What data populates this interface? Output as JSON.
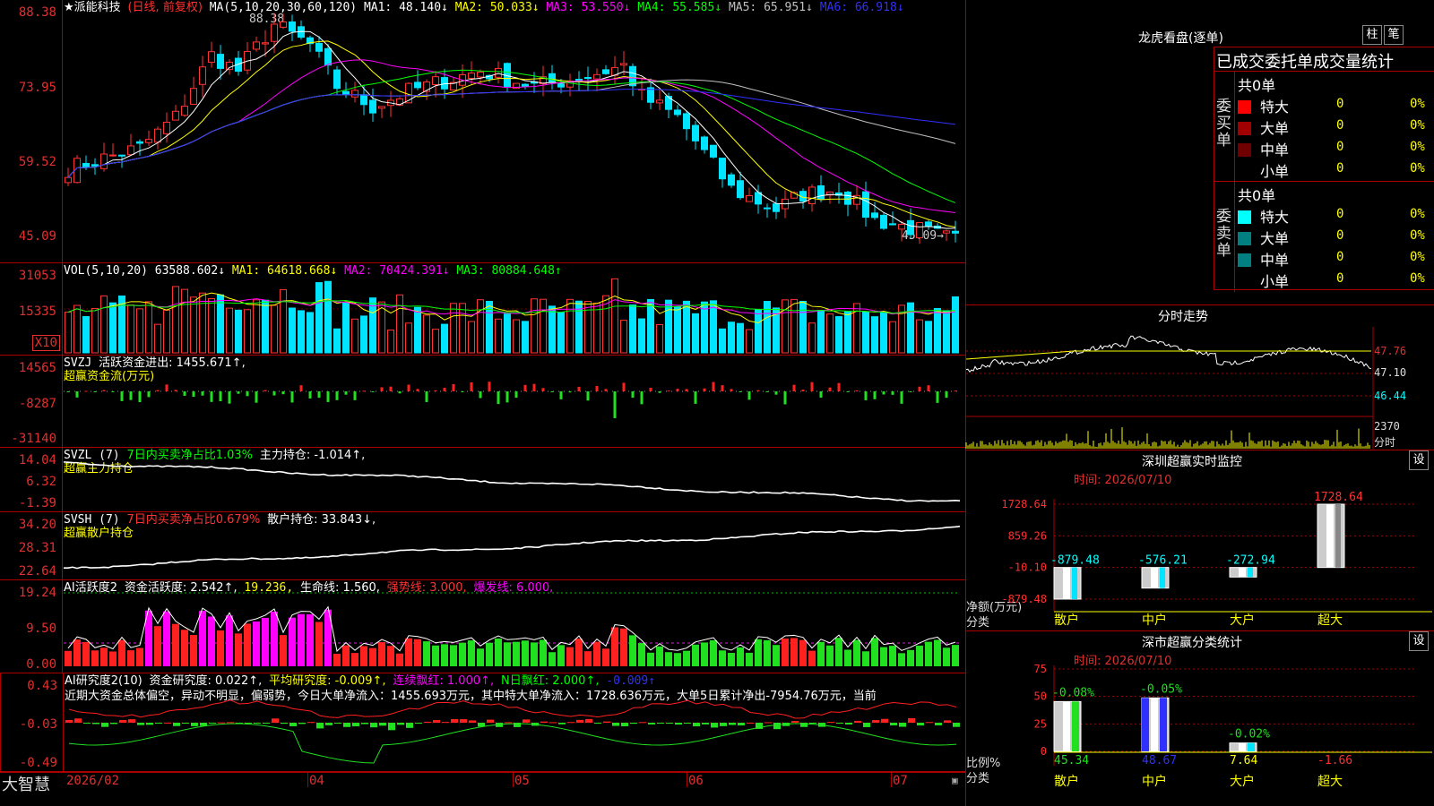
{
  "header": {
    "stock": "★派能科技",
    "mode": "(日线, 前复权)",
    "ma_title": "MA(5,10,20,30,60,120)",
    "ma": [
      {
        "label": "MA1: 48.140↓",
        "color": "#ffffff"
      },
      {
        "label": "MA2: 50.033↓",
        "color": "#ffff00"
      },
      {
        "label": "MA3: 53.550↓",
        "color": "#ff00ff"
      },
      {
        "label": "MA4: 55.585↓",
        "color": "#00ff00"
      },
      {
        "label": "MA5: 65.951↓",
        "color": "#c0c0c0"
      },
      {
        "label": "MA6: 66.918↓",
        "color": "#3030ff"
      }
    ],
    "high_label": "88.38",
    "low_label": "45.09→"
  },
  "price_axis": [
    "88.38",
    "73.95",
    "59.52",
    "45.09"
  ],
  "vol": {
    "title": "VOL(5,10,20)",
    "value": "63588.602↓",
    "ma1": "MA1: 64618.668↓",
    "ma2": "MA2: 70424.391↓",
    "ma3": "MA3: 80884.648↑",
    "axis": [
      "31053",
      "15335",
      "X10"
    ]
  },
  "svzj": {
    "title": "SVZJ",
    "label": "活跃资金进出: 1455.671↑,",
    "sub": "超赢资金流(万元)",
    "axis": [
      "14565",
      "-8287",
      "-31140"
    ]
  },
  "svzl": {
    "title": "SVZL (7)",
    "ratio": "7日内买卖净占比1.03%",
    "label": "主力持仓: -1.014↑,",
    "sub": "超赢主力持仓",
    "axis": [
      "14.04",
      "6.32",
      "-1.39"
    ]
  },
  "svsh": {
    "title": "SVSH (7)",
    "ratio": "7日内买卖净占比0.679%",
    "label": "散户持仓: 33.843↓,",
    "sub": "超赢散户持仓",
    "axis": [
      "34.20",
      "28.31",
      "22.64"
    ]
  },
  "ai1": {
    "title": "AI活跃度2",
    "label": "资金活跃度: 2.542↑,",
    "v2": "19.236,",
    "life": "生命线: 1.560,",
    "strong": "强势线: 3.000,",
    "burst": "爆发线: 6.000,",
    "axis": [
      "19.24",
      "9.50",
      "0.00"
    ]
  },
  "ai2": {
    "title": "AI研究度2(10)",
    "label": "资金研究度: 0.022↑,",
    "avg": "平均研究度: -0.009↑,",
    "red": "连续飘红: 1.000↑,",
    "nred": "N日飘红: 2.000↑,",
    "last": "-0.009↑",
    "text": "近期大资金总体偏空，异动不明显，偏弱势，今日大单净流入：1455.693万元，其中特大单净流入：1728.636万元，大单5日累计净出-7954.76万元，当前",
    "axis": [
      "0.43",
      "-0.03",
      "-0.49"
    ]
  },
  "date_axis": {
    "brand": "大智慧",
    "labels": [
      "2026/02",
      "04",
      "05",
      "06",
      "07"
    ]
  },
  "lhb": {
    "title": "龙虎看盘(逐单)",
    "btn1": "柱",
    "btn2": "笔",
    "subtitle": "已成交委托单成交量统计",
    "buy_label": "委买单",
    "sell_label": "委卖单",
    "buy_total": "共0单",
    "sell_total": "共0单",
    "buy_rows": [
      {
        "name": "特大",
        "count": "0",
        "pct": "0%",
        "color": "#ff0000"
      },
      {
        "name": "大单",
        "count": "0",
        "pct": "0%",
        "color": "#a00000"
      },
      {
        "name": "中单",
        "count": "0",
        "pct": "0%",
        "color": "#700000"
      },
      {
        "name": "小单",
        "count": "0",
        "pct": "0%",
        "color": ""
      }
    ],
    "sell_rows": [
      {
        "name": "特大",
        "count": "0",
        "pct": "0%",
        "color": "#00ffff"
      },
      {
        "name": "大单",
        "count": "0",
        "pct": "0%",
        "color": "#008080"
      },
      {
        "name": "中单",
        "count": "0",
        "pct": "0%",
        "color": "#008080"
      },
      {
        "name": "小单",
        "count": "0",
        "pct": "0%",
        "color": ""
      }
    ]
  },
  "intraday": {
    "title": "分时走势",
    "axis": [
      "47.76",
      "47.10",
      "46.44"
    ],
    "vol_label": "2370",
    "vol_unit": "分时"
  },
  "monitor": {
    "title": "深圳超赢实时监控",
    "btn": "设",
    "date": "时间: 2026/07/10",
    "axis": [
      "1728.64",
      "859.26",
      "-10.10",
      "-879.48"
    ],
    "ylabel1": "净额(万元)",
    "ylabel2": "分类"
  },
  "classify": {
    "title": "深市超赢分类统计",
    "btn": "设",
    "date": "时间: 2026/07/10",
    "axis": [
      "75",
      "50",
      "25",
      "0"
    ],
    "ylabel1": "比例%",
    "ylabel2": "分类"
  },
  "chart_data": [
    {
      "type": "bar",
      "title": "深圳超赢实时监控",
      "categories": [
        "散户",
        "中户",
        "大户",
        "超大"
      ],
      "values": [
        -879.48,
        -576.21,
        -272.94,
        1728.64
      ],
      "ylim": [
        -879.48,
        1728.64
      ],
      "ylabel": "净额(万元)",
      "xlabel": "分类"
    },
    {
      "type": "bar",
      "title": "深市超赢分类统计",
      "categories": [
        "散户",
        "中户",
        "大户",
        "超大"
      ],
      "values": [
        45.34,
        48.67,
        7.64,
        -1.66
      ],
      "labels": [
        "-0.08%",
        "-0.05%",
        "-0.02%",
        ""
      ],
      "ylim": [
        0,
        75
      ],
      "ylabel": "比例%",
      "xlabel": "分类"
    }
  ]
}
